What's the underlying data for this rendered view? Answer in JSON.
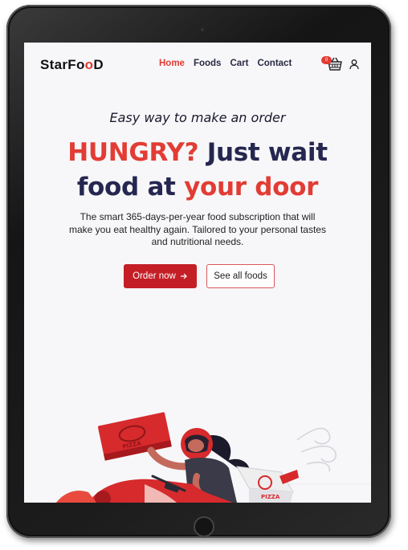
{
  "brand": {
    "part1": "StarFo",
    "part2": "o",
    "part3": "D"
  },
  "nav": {
    "items": [
      {
        "label": "Home",
        "active": true
      },
      {
        "label": "Foods",
        "active": false
      },
      {
        "label": "Cart",
        "active": false
      },
      {
        "label": "Contact",
        "active": false
      }
    ],
    "cart_count": "0"
  },
  "hero": {
    "tagline": "Easy way to make an order",
    "headline_red1": "HUNGRY?",
    "headline_dark1": " Just wait",
    "headline_dark2": "food at ",
    "headline_red2": "your door",
    "description": "The smart 365-days-per-year food subscription that will make you eat healthy again. Tailored to your personal tastes and nutritional needs.",
    "primary_button": "Order now",
    "secondary_button": "See all foods"
  },
  "illustration": {
    "box_label": "PIZZA",
    "scooter_label": "PIZZA"
  },
  "colors": {
    "accent": "#e23c34",
    "primary_button": "#c41f27",
    "heading": "#252750"
  }
}
